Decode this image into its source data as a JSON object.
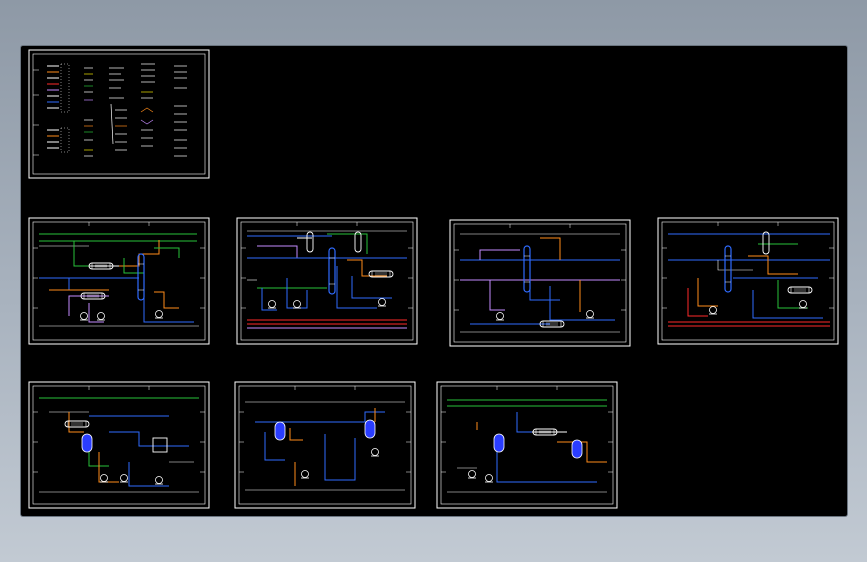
{
  "viewer": {
    "background": "#000000",
    "page_background": "#9aa5b1"
  },
  "colors": {
    "frame": "#ffffff",
    "green_line": "#29c23a",
    "blue_line": "#2f6bff",
    "orange_line": "#ff8c1a",
    "purple_line": "#c58cff",
    "yellow_line": "#f2e600",
    "red_line": "#ff2a2a",
    "cyan_line": "#3ad6e6",
    "vessel": "#2a3dff"
  },
  "sheets": [
    {
      "id": "legend",
      "kind": "legend"
    },
    {
      "id": "pid-1",
      "kind": "pid"
    },
    {
      "id": "pid-2",
      "kind": "pid"
    },
    {
      "id": "pid-3",
      "kind": "pid"
    },
    {
      "id": "pid-4",
      "kind": "pid"
    },
    {
      "id": "pid-5",
      "kind": "pid"
    },
    {
      "id": "pid-6",
      "kind": "pid"
    },
    {
      "id": "pid-7",
      "kind": "pid"
    }
  ]
}
